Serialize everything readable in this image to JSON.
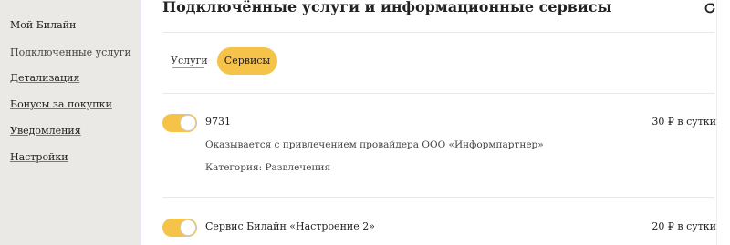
{
  "sidebar": {
    "items": [
      {
        "label": "Мой Билайн"
      },
      {
        "label": "Подключенные услуги"
      },
      {
        "label": "Детализация"
      },
      {
        "label": "Бонусы за покупки"
      },
      {
        "label": "Уведомления"
      },
      {
        "label": "Настройки"
      }
    ],
    "active_index": 1
  },
  "header": {
    "title": "Подключённые услуги и информационные сервисы",
    "refresh_icon": "refresh-icon"
  },
  "tabs": [
    {
      "label": "Услуги",
      "selected": false
    },
    {
      "label": "Сервисы",
      "selected": true
    }
  ],
  "services": [
    {
      "name": "9731",
      "price": "30 ₽ в сутки",
      "provider": "Оказывается с привлечением провайдера ООО «Информпартнер»",
      "category": "Категория: Развлечения",
      "enabled": true
    },
    {
      "name": "Сервис Билайн «Настроение 2»",
      "price": "20 ₽ в сутки",
      "enabled": true
    }
  ],
  "colors": {
    "accent": "#f5c24a",
    "sidebar_bg": "#ebe9e5"
  }
}
